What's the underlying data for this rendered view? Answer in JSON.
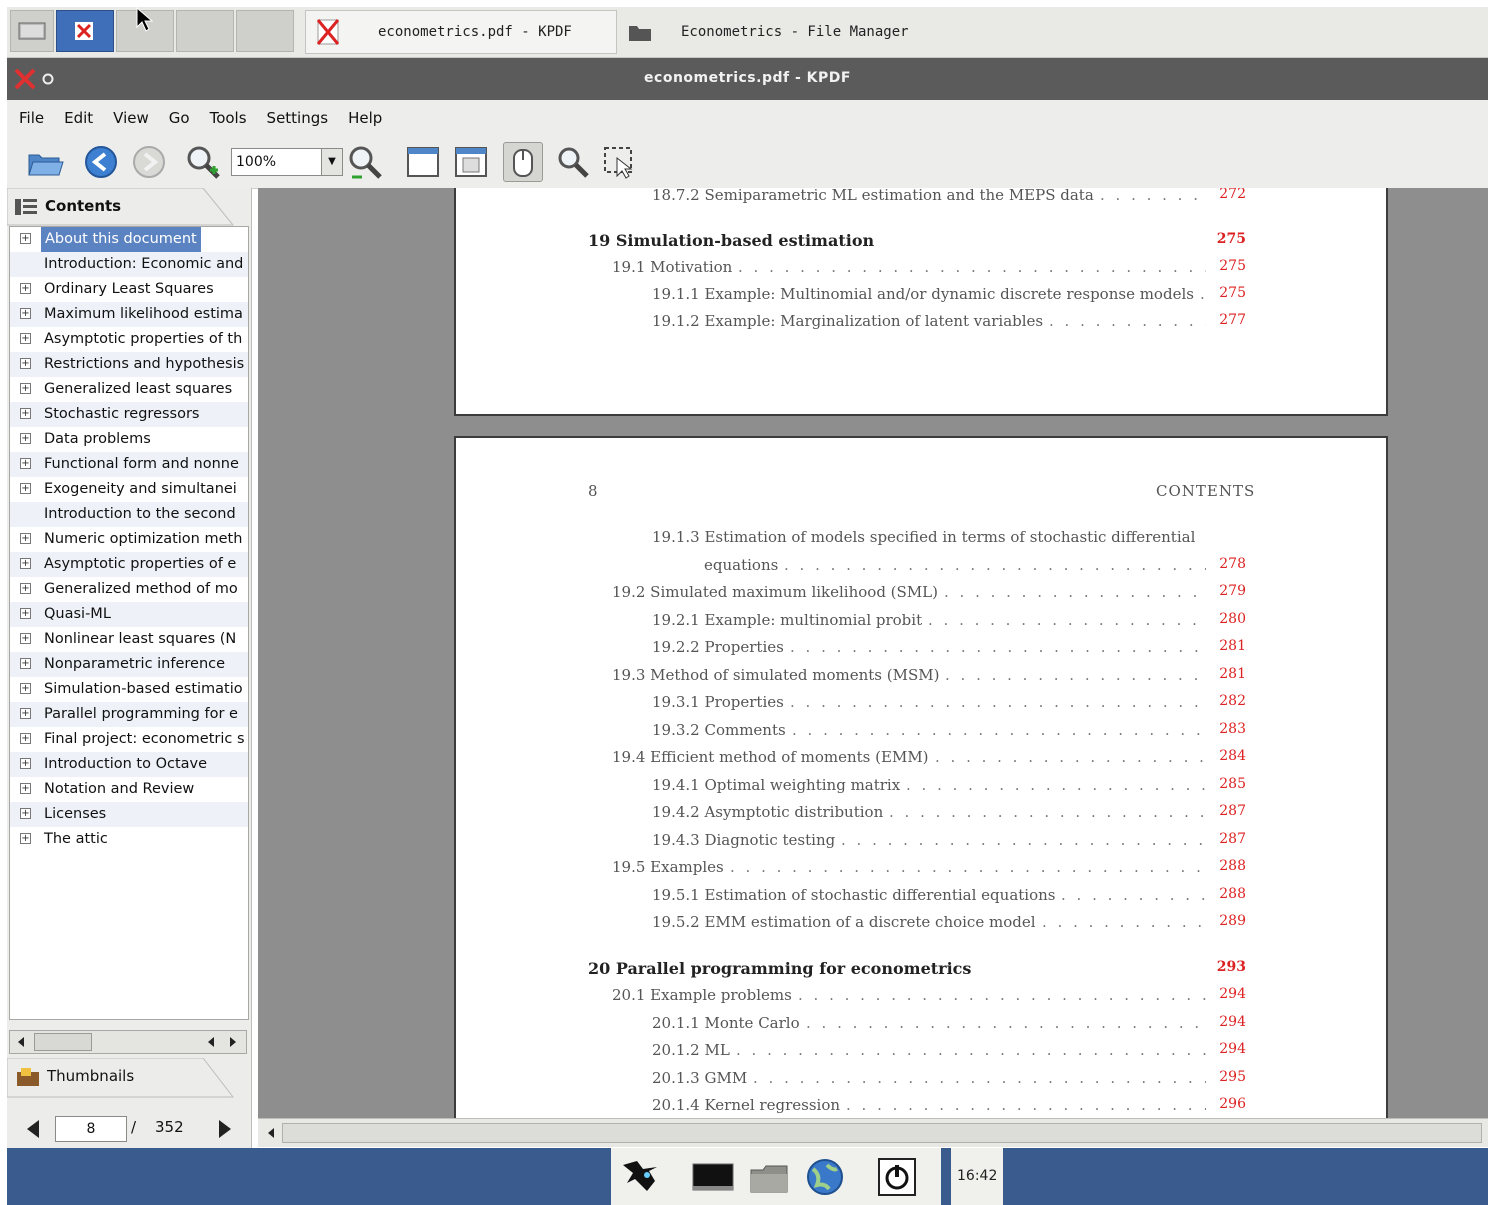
{
  "taskbar": {
    "task1_label": "econometrics.pdf - KPDF",
    "task2_label": "Econometrics - File Manager"
  },
  "window": {
    "title": "econometrics.pdf - KPDF"
  },
  "menu": [
    "File",
    "Edit",
    "View",
    "Go",
    "Tools",
    "Settings",
    "Help"
  ],
  "toolbar": {
    "zoom_value": "100%"
  },
  "sidebar": {
    "contents_label": "Contents",
    "thumbnails_label": "Thumbnails",
    "items": [
      {
        "label": "About this document",
        "expander": true
      },
      {
        "label": "Introduction: Economic and",
        "expander": false
      },
      {
        "label": "Ordinary Least Squares",
        "expander": true
      },
      {
        "label": "Maximum likelihood estima",
        "expander": true
      },
      {
        "label": "Asymptotic properties of th",
        "expander": true
      },
      {
        "label": "Restrictions and hypothesis",
        "expander": true
      },
      {
        "label": "Generalized least squares",
        "expander": true
      },
      {
        "label": "Stochastic regressors",
        "expander": true
      },
      {
        "label": "Data problems",
        "expander": true
      },
      {
        "label": "Functional form and nonne",
        "expander": true
      },
      {
        "label": "Exogeneity and simultanei",
        "expander": true
      },
      {
        "label": "Introduction to the second",
        "expander": false
      },
      {
        "label": "Numeric optimization meth",
        "expander": true
      },
      {
        "label": "Asymptotic properties of e",
        "expander": true
      },
      {
        "label": "Generalized method of mo",
        "expander": true
      },
      {
        "label": "Quasi-ML",
        "expander": true
      },
      {
        "label": "Nonlinear least squares (N",
        "expander": true
      },
      {
        "label": "Nonparametric inference",
        "expander": true
      },
      {
        "label": "Simulation-based estimatio",
        "expander": true
      },
      {
        "label": "Parallel programming for e",
        "expander": true
      },
      {
        "label": "Final project: econometric s",
        "expander": true
      },
      {
        "label": "Introduction to Octave",
        "expander": true
      },
      {
        "label": "Notation and Review",
        "expander": true
      },
      {
        "label": "Licenses",
        "expander": true
      },
      {
        "label": "The attic",
        "expander": true
      }
    ],
    "selected_index": 0
  },
  "pager": {
    "current": "8",
    "separator": "/",
    "total": "352"
  },
  "document": {
    "page1": [
      {
        "text": "18.7.2  Semiparametric ML estimation and the MEPS data",
        "page": "272",
        "level": 2
      },
      {
        "text": "19  Simulation-based estimation",
        "page": "275",
        "level": 0
      },
      {
        "text": "19.1  Motivation",
        "page": "275",
        "level": 1
      },
      {
        "text": "19.1.1  Example: Multinomial and/or dynamic discrete response models",
        "page": "275",
        "level": 2
      },
      {
        "text": "19.1.2  Example: Marginalization of latent variables",
        "page": "277",
        "level": 2
      }
    ],
    "page2_header_left": "8",
    "page2_header_right": "CONTENTS",
    "page2": [
      {
        "text": "19.1.3  Estimation of models specified in terms of stochastic differential",
        "page": "",
        "level": 2
      },
      {
        "text": "equations",
        "page": "278",
        "level": 3
      },
      {
        "text": "19.2  Simulated maximum likelihood (SML)",
        "page": "279",
        "level": 1
      },
      {
        "text": "19.2.1  Example: multinomial probit",
        "page": "280",
        "level": 2
      },
      {
        "text": "19.2.2  Properties",
        "page": "281",
        "level": 2
      },
      {
        "text": "19.3  Method of simulated moments (MSM)",
        "page": "281",
        "level": 1
      },
      {
        "text": "19.3.1  Properties",
        "page": "282",
        "level": 2
      },
      {
        "text": "19.3.2  Comments",
        "page": "283",
        "level": 2
      },
      {
        "text": "19.4  Efficient method of moments (EMM)",
        "page": "284",
        "level": 1
      },
      {
        "text": "19.4.1  Optimal weighting matrix",
        "page": "285",
        "level": 2
      },
      {
        "text": "19.4.2  Asymptotic distribution",
        "page": "287",
        "level": 2
      },
      {
        "text": "19.4.3  Diagnotic testing",
        "page": "287",
        "level": 2
      },
      {
        "text": "19.5  Examples",
        "page": "288",
        "level": 1
      },
      {
        "text": "19.5.1  Estimation of stochastic differential equations",
        "page": "288",
        "level": 2
      },
      {
        "text": "19.5.2  EMM estimation of a discrete choice model",
        "page": "289",
        "level": 2
      },
      {
        "text": "20  Parallel programming for econometrics",
        "page": "293",
        "level": 0
      },
      {
        "text": "20.1  Example problems",
        "page": "294",
        "level": 1
      },
      {
        "text": "20.1.1  Monte Carlo",
        "page": "294",
        "level": 2
      },
      {
        "text": "20.1.2  ML",
        "page": "294",
        "level": 2
      },
      {
        "text": "20.1.3  GMM",
        "page": "295",
        "level": 2
      },
      {
        "text": "20.1.4  Kernel regression",
        "page": "296",
        "level": 2
      }
    ]
  },
  "clock": "16:42"
}
